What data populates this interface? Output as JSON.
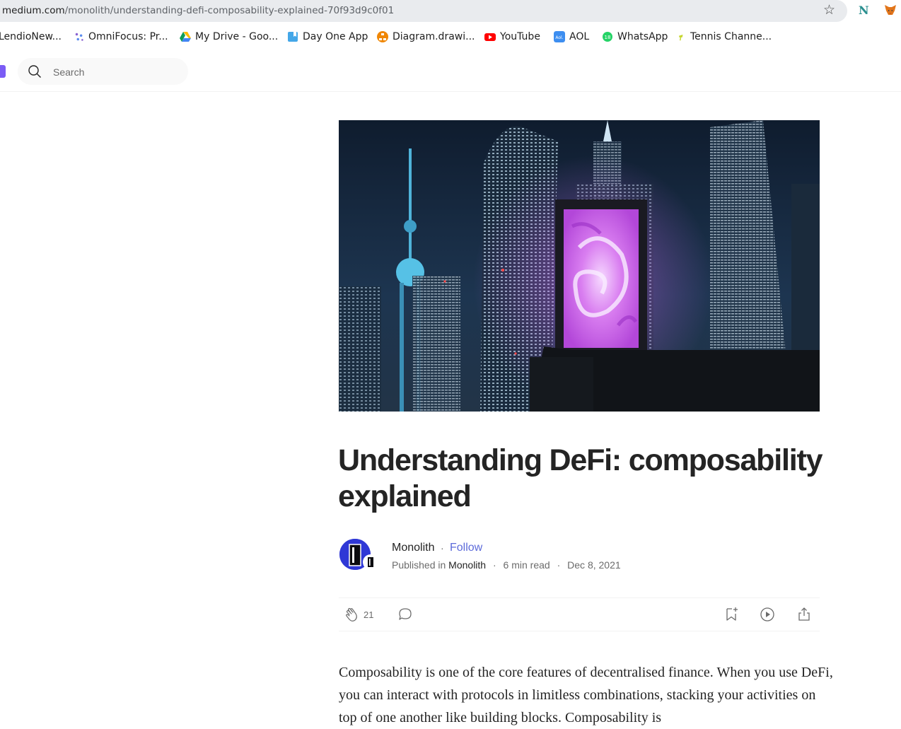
{
  "browser": {
    "url_host": "medium.com",
    "url_path": "/monolith/understanding-defi-composability-explained-70f93d9c0f01"
  },
  "bookmarks": [
    {
      "label": "LendioNew...",
      "icon": "lendio-icon"
    },
    {
      "label": "OmniFocus: Pr...",
      "icon": "omnifocus-icon"
    },
    {
      "label": "My Drive - Goo...",
      "icon": "google-drive-icon"
    },
    {
      "label": "Day One App",
      "icon": "dayone-icon"
    },
    {
      "label": "Diagram.drawi...",
      "icon": "drawio-icon"
    },
    {
      "label": "YouTube",
      "icon": "youtube-icon"
    },
    {
      "label": "AOL",
      "icon": "aol-icon"
    },
    {
      "label": "WhatsApp",
      "icon": "whatsapp-icon"
    },
    {
      "label": "Tennis Channe...",
      "icon": "tennis-channel-icon"
    }
  ],
  "header": {
    "search_placeholder": "Search"
  },
  "article": {
    "title": "Understanding DeFi: composability explained",
    "author": "Monolith",
    "separator": "·",
    "follow_label": "Follow",
    "published_prefix": "Published in",
    "publication": "Monolith",
    "read_time": "6 min read",
    "date": "Dec 8, 2021",
    "claps": "21",
    "body_first_paragraph": "Composability is one of the core features of decentralised finance. When you use DeFi, you can interact with protocols in limitless combinations, stacking your activities on top of one another like building blocks. Composability is"
  },
  "colors": {
    "accent_follow": "#5d6bda",
    "logo": "#7b5cf5",
    "avatar_bg": "#2f38d6"
  }
}
